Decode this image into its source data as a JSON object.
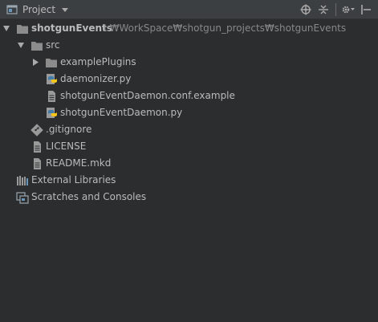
{
  "toolbar": {
    "title": "Project",
    "icons": [
      "project-view-icon",
      "dropdown-caret-icon",
      "locate-icon",
      "collapse-all-icon",
      "settings-gear-icon",
      "hide-panel-icon"
    ]
  },
  "tree": {
    "root": {
      "label": "shotgunEvents",
      "path": "I:₩WorkSpace₩shotgun_projects₩shotgunEvents",
      "expanded": true
    },
    "src": {
      "label": "src",
      "expanded": true
    },
    "example_plugins": {
      "label": "examplePlugins",
      "expanded": false
    },
    "daemonizer": {
      "label": "daemonizer.py"
    },
    "conf_example": {
      "label": "shotgunEventDaemon.conf.example"
    },
    "daemon_py": {
      "label": "shotgunEventDaemon.py"
    },
    "gitignore": {
      "label": ".gitignore"
    },
    "license": {
      "label": "LICENSE"
    },
    "readme": {
      "label": "README.mkd"
    },
    "external_libraries": {
      "label": "External Libraries"
    },
    "scratches": {
      "label": "Scratches and Consoles"
    }
  },
  "colors": {
    "background": "#2b2d2f",
    "toolbar": "#3c3f41",
    "text": "#bbbbbb",
    "path_text": "#888888",
    "folder": "#8c8c8c",
    "python_blue": "#3f7cac",
    "python_yellow": "#f5c518"
  }
}
